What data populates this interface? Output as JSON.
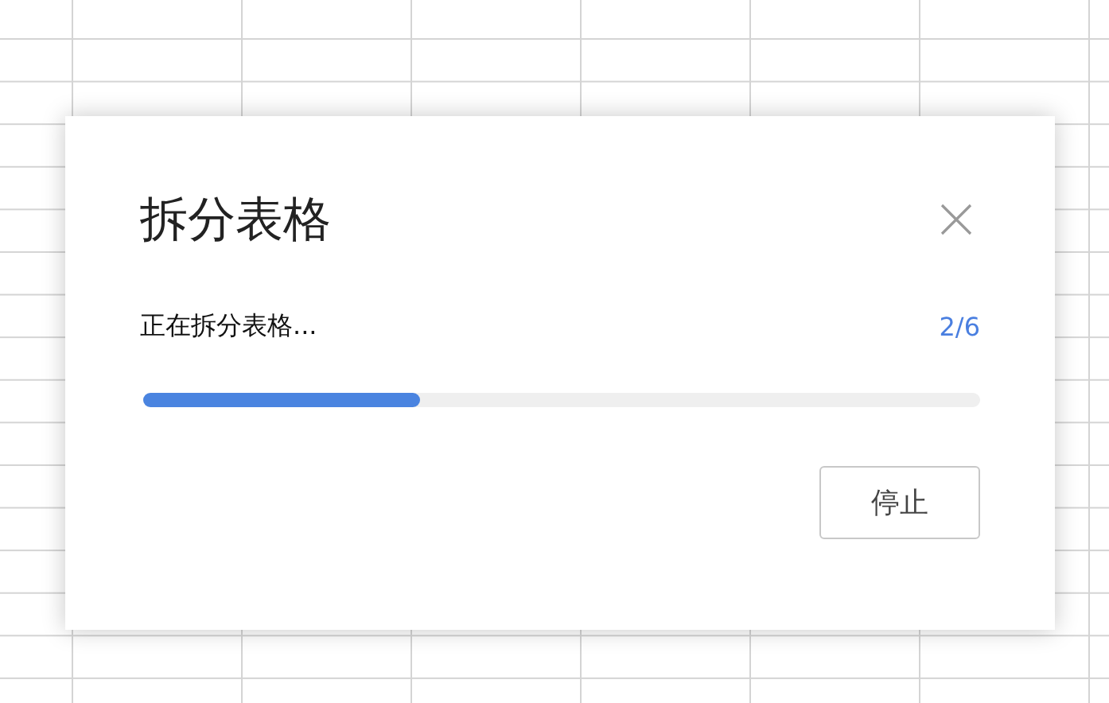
{
  "dialog": {
    "title": "拆分表格",
    "status": "正在拆分表格...",
    "counter": "2/6",
    "progress": {
      "level": 0.33
    },
    "buttons": [
      {
        "label": "停止"
      }
    ]
  }
}
